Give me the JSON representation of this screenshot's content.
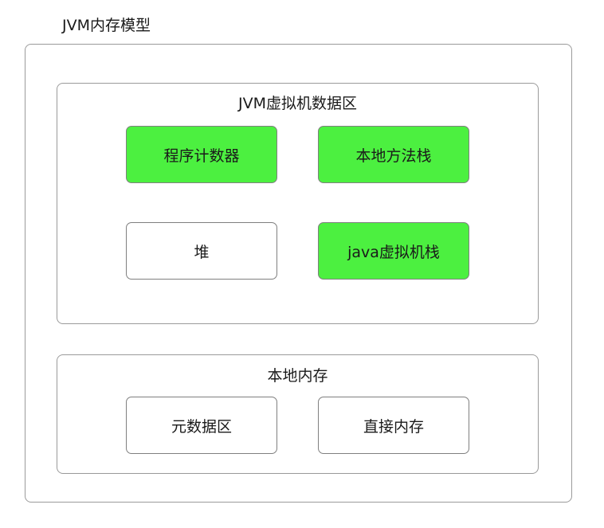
{
  "diagram": {
    "title": "JVM内存模型",
    "jvm_area": {
      "label": "JVM虚拟机数据区",
      "blocks": [
        {
          "label": "程序计数器",
          "color": "#4cf040"
        },
        {
          "label": "本地方法栈",
          "color": "#4cf040"
        },
        {
          "label": "堆",
          "color": "#ffffff"
        },
        {
          "label": "java虚拟机栈",
          "color": "#4cf040"
        }
      ]
    },
    "native_memory": {
      "label": "本地内存",
      "blocks": [
        {
          "label": "元数据区",
          "color": "#ffffff"
        },
        {
          "label": "直接内存",
          "color": "#ffffff"
        }
      ]
    }
  }
}
